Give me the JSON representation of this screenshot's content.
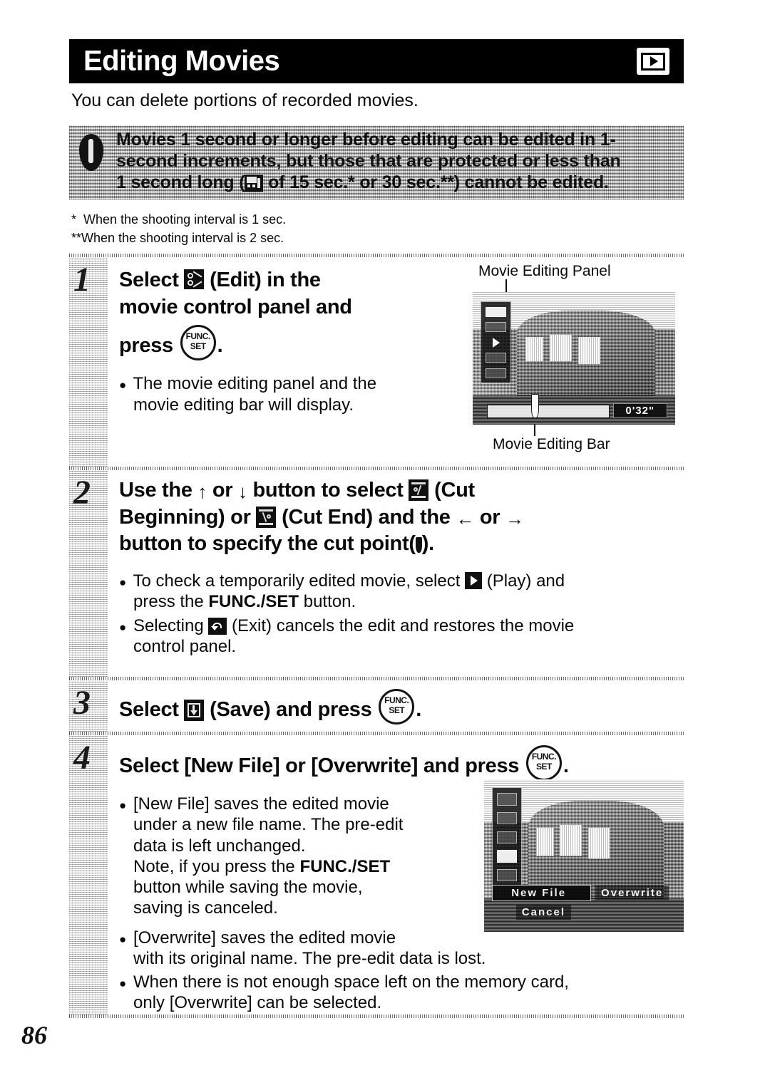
{
  "header": {
    "title": "Editing Movies",
    "mode_icon": "playback-movie-icon"
  },
  "intro": "You can delete portions of recorded movies.",
  "caution": {
    "icon": "exclamation-icon",
    "line1": "Movies 1 second or longer before editing can be edited in 1-",
    "line2": "second increments, but those that are protected or less than",
    "line3_a": "1 second long (",
    "line3_icon": "movie-clip-icon",
    "line3_b": " of 15 sec.* or 30 sec.**) cannot be edited."
  },
  "footnotes": [
    "*  When the shooting interval is 1 sec.",
    "**When the shooting interval is 2 sec."
  ],
  "steps": [
    {
      "number": "1",
      "headline_1a": "Select ",
      "headline_icon": "scissors-edit-icon",
      "headline_1b": " (Edit) in the",
      "headline_2": "movie control panel and",
      "headline_3": "press",
      "func_top": "FUNC.",
      "func_bottom": "SET",
      "headline_end": ".",
      "bullets": [
        "The movie editing panel and the",
        "movie editing bar will display."
      ],
      "figure": {
        "caption_top": "Movie Editing Panel",
        "caption_bottom": "Movie Editing Bar",
        "timecode": "0'32\""
      }
    },
    {
      "number": "2",
      "headline_a": "Use the ",
      "arrow_up": "↑",
      "headline_b": " or ",
      "arrow_down": "↓",
      "headline_c": " button to select ",
      "icon_cut_beginning": "cut-beginning-icon",
      "headline_d": " (Cut",
      "headline_e": "Beginning) or ",
      "icon_cut_end": "cut-end-icon",
      "headline_f": " (Cut End) and the ",
      "arrow_left": "←",
      "headline_g": " or ",
      "arrow_right": "→",
      "headline_h": "button to specify the cut point(",
      "icon_marker": "cut-point-marker-icon",
      "headline_i": ").",
      "bullets": [
        {
          "pre": "To check a temporarily edited movie, select ",
          "icon": "play-icon",
          "post": " (Play) and",
          "line2_pre": "press the ",
          "line2_bold": "FUNC./SET",
          "line2_post": " button."
        },
        {
          "pre": "Selecting ",
          "icon": "exit-icon",
          "post": " (Exit) cancels the edit and restores the movie",
          "line2": "control panel."
        }
      ]
    },
    {
      "number": "3",
      "headline_a": "Select ",
      "icon_save": "save-icon",
      "headline_b": " (Save) and press",
      "func_top": "FUNC.",
      "func_bottom": "SET",
      "headline_end": "."
    },
    {
      "number": "4",
      "headline_a": "Select [New File] or [Overwrite] and press",
      "func_top": "FUNC.",
      "func_bottom": "SET",
      "headline_end": ".",
      "bullets": [
        {
          "lines": [
            "[New File] saves the edited movie",
            "under a new file name. The pre-edit",
            "data is left unchanged."
          ],
          "note_pre": "Note, if you press the ",
          "note_bold": "FUNC./SET",
          "note_lines": [
            "button while saving the movie,",
            "saving is canceled."
          ]
        },
        {
          "lines": [
            "[Overwrite] saves the edited movie",
            "with its original name. The pre-edit data is lost."
          ]
        },
        {
          "lines": [
            "When there is not enough space left on the memory card,",
            "only [Overwrite] can be selected."
          ]
        }
      ],
      "figure": {
        "menu_new_file": "New File",
        "menu_overwrite": "Overwrite",
        "menu_cancel": "Cancel"
      }
    }
  ],
  "page_number": "86"
}
